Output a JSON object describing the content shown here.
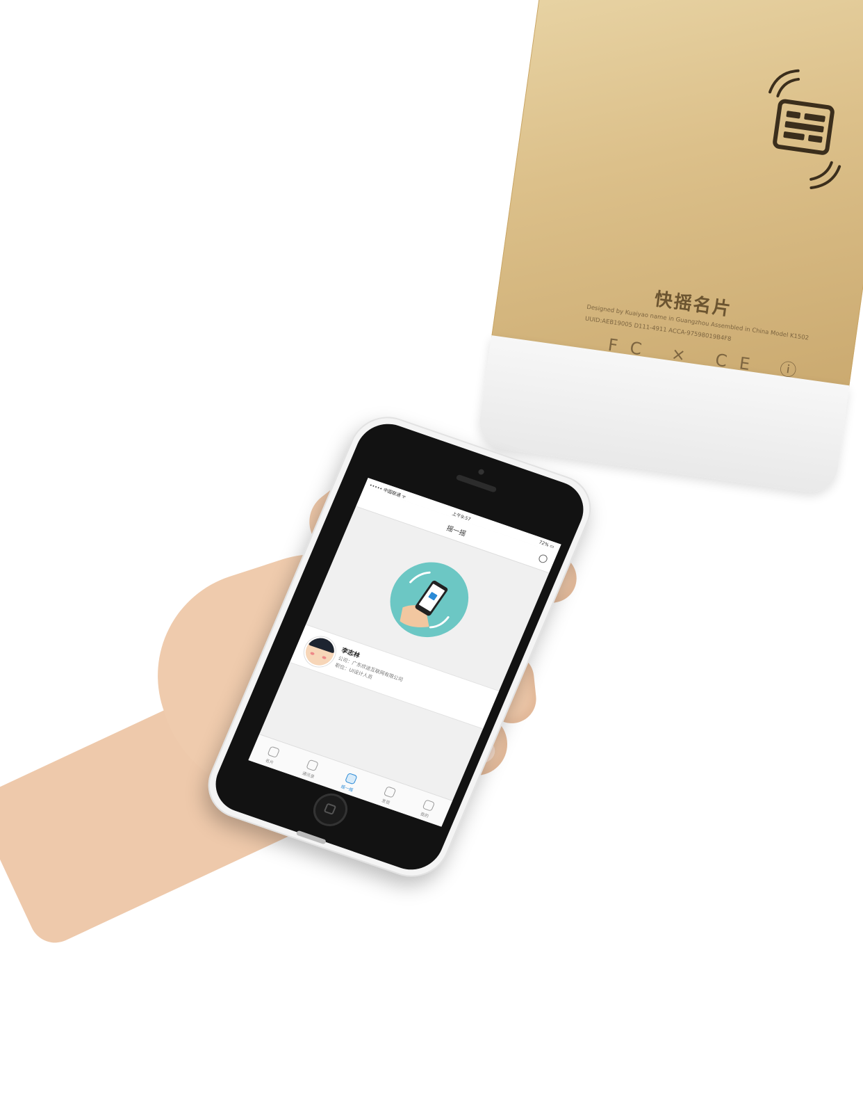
{
  "gold_device": {
    "brand": "快摇名片",
    "fine_print_1": "Designed by Kuaiyao name in Guangzhou Assembled in China Model K1502",
    "fine_print_2": "UUID:AEB19005 D111-4911 ACCA-97598019B4F8",
    "cert_marks": "FC ⨯ CE ⓘ",
    "logo_icon": "card-wave-icon",
    "colors": {
      "gold": "#dcc08a",
      "logo": "#3b2e1c"
    }
  },
  "phone": {
    "status_bar": {
      "carrier": "••••• 中国联通 ᯤ",
      "time": "上午9:57",
      "battery": "72% ▭"
    },
    "nav_title": "摇一摇",
    "history_icon": "history-icon",
    "illustration_icon": "hand-shake-phone-icon",
    "card": {
      "name": "李志林",
      "company": "公司：广东欣途互联网有限公司",
      "position": "职位：UI设计人员"
    },
    "tabs": [
      {
        "label": "名片",
        "icon": "card-icon"
      },
      {
        "label": "通讯录",
        "icon": "contacts-icon"
      },
      {
        "label": "摇一摇",
        "icon": "shake-icon",
        "active": true
      },
      {
        "label": "发现",
        "icon": "discover-icon"
      },
      {
        "label": "我的",
        "icon": "profile-icon"
      }
    ],
    "colors": {
      "accent": "#2a8ad6",
      "illustration_bg": "#6cc7c4"
    }
  }
}
